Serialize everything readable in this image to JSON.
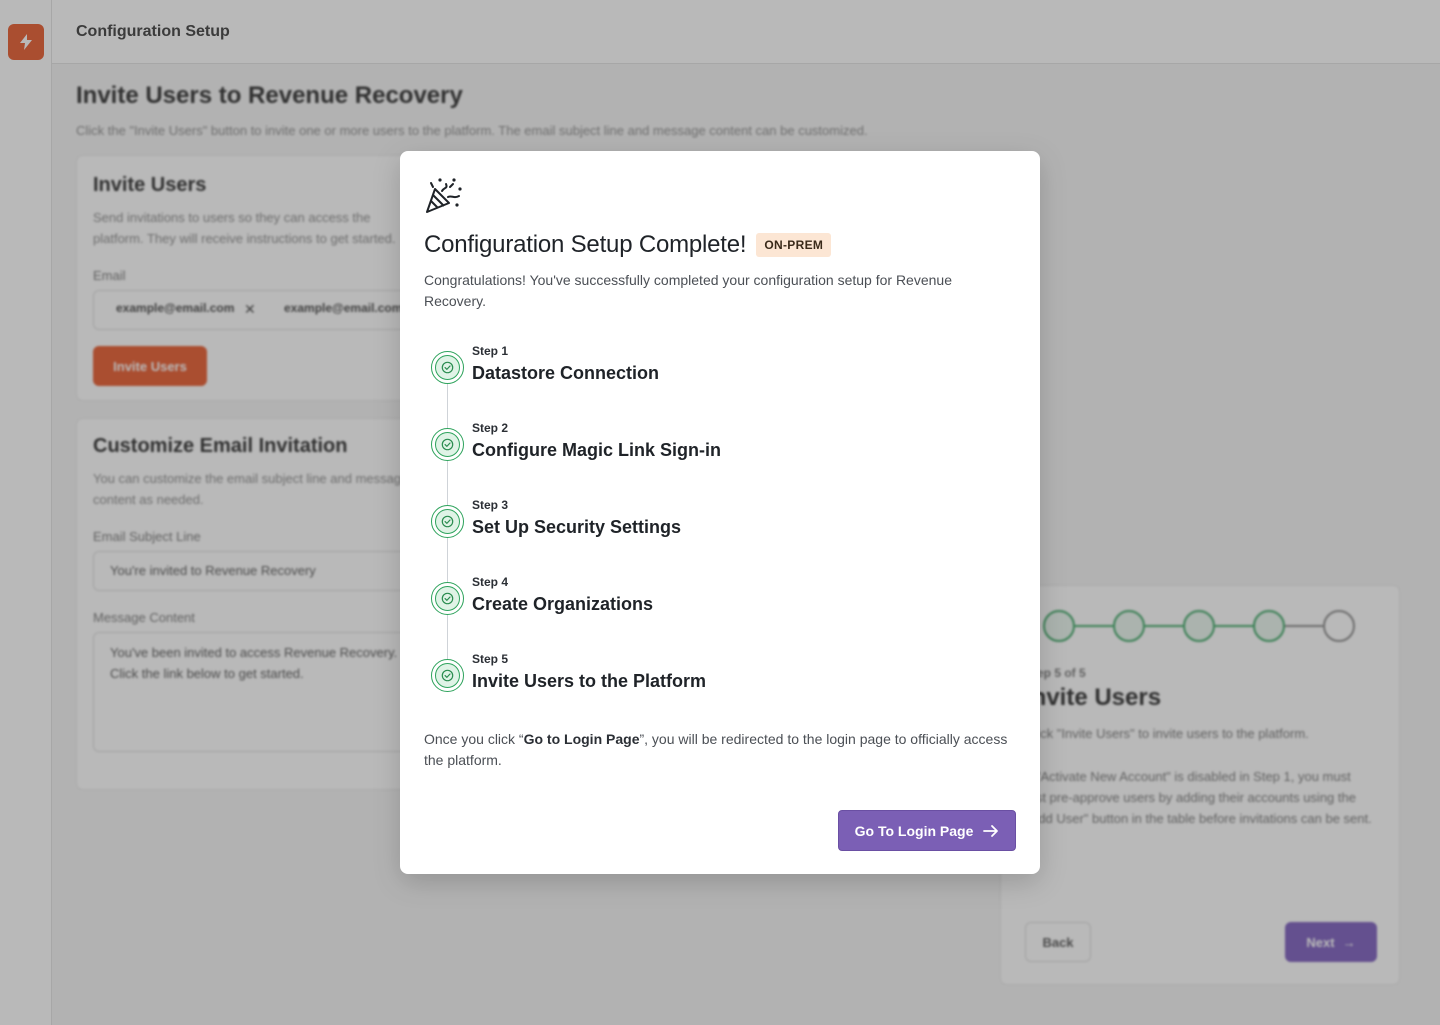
{
  "app": {
    "header_title": "Configuration Setup"
  },
  "background": {
    "page_title": "Invite Users to Revenue Recovery",
    "page_subtitle": "Click the \"Invite Users\" button to invite one or more users to the platform. The email subject line and message content can be customized.",
    "invite_card": {
      "title": "Invite Users",
      "description": "Send invitations to users so they can access the platform. They will receive instructions to get started.",
      "email_label": "Email",
      "chips": [
        "example@email.com",
        "example@email.com"
      ],
      "button": "Invite Users"
    },
    "custom_card": {
      "title": "Customize Email Invitation",
      "description": "You can customize the email subject line and message content as needed.",
      "subject_label": "Email Subject Line",
      "subject_value": "You're invited to Revenue Recovery",
      "message_label": "Message Content",
      "message_value": "You've been invited to access Revenue Recovery. Click the link below to get started."
    },
    "stepper": {
      "step_counter": "Step 5 of 5",
      "title": "Invite Users",
      "line1": "Click \"Invite Users\" to invite users to the platform.",
      "line2": "If \"Activate New Account\" is disabled in Step 1, you must first pre-approve users by adding their accounts using the \"Add User\" button in the table before invitations can be sent.",
      "back": "Back",
      "next": "Next"
    }
  },
  "modal": {
    "icon": "party-popper-icon",
    "title": "Configuration Setup Complete!",
    "badge": "ON-PREM",
    "description": "Congratulations! You've successfully completed your configuration setup for Revenue Recovery.",
    "steps": [
      {
        "num": "Step 1",
        "name": "Datastore Connection",
        "status": "complete"
      },
      {
        "num": "Step 2",
        "name": "Configure Magic Link Sign-in",
        "status": "complete"
      },
      {
        "num": "Step 3",
        "name": "Set Up Security Settings",
        "status": "complete"
      },
      {
        "num": "Step 4",
        "name": "Create Organizations",
        "status": "complete"
      },
      {
        "num": "Step 5",
        "name": "Invite Users to the Platform",
        "status": "complete"
      }
    ],
    "footer_pre": "Once you click “",
    "footer_bold": "Go to Login Page",
    "footer_post": "”, you will be redirected to the login page to officially access the platform.",
    "button": "Go To Login Page"
  },
  "colors": {
    "brand_orange": "#e8582a",
    "primary_purple": "#7b5fb5",
    "success_green": "#2ea35c",
    "badge_bg": "#fce6d4"
  }
}
